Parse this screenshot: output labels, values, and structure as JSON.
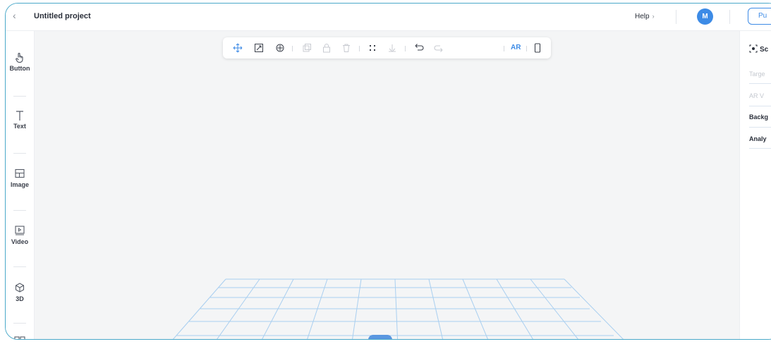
{
  "topbar": {
    "back_icon": "chevron-left-icon",
    "back_glyph": "‹",
    "project_title": "Untitled project",
    "help_label": "Help",
    "help_arrow": "›",
    "avatar_initial": "M",
    "publish_label": "Pu"
  },
  "sidebar": {
    "items": [
      {
        "label": "Button",
        "icon": "hand-pointer-icon"
      },
      {
        "label": "Text",
        "icon": "text-t-icon"
      },
      {
        "label": "Image",
        "icon": "image-icon"
      },
      {
        "label": "Video",
        "icon": "video-icon"
      },
      {
        "label": "3D",
        "icon": "cube-icon"
      },
      {
        "label": "",
        "icon": "more-blocks-icon"
      }
    ]
  },
  "canvas_toolbar": {
    "ar_label": "AR"
  },
  "right_panel": {
    "scene_label": "Sc",
    "faint_1": "Targe",
    "faint_2": "AR V",
    "background_label": "Backg",
    "analytics_label": "Analy"
  },
  "colors": {
    "accent": "#3d8be6",
    "frame_border": "#4aa9c9",
    "grid": "#a9cff0"
  }
}
